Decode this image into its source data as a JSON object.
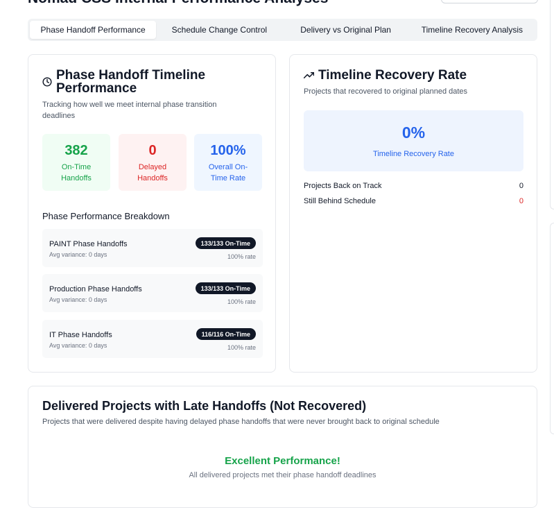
{
  "header": {
    "title_partial": "Nomad CSS Internal Performance Analyses"
  },
  "tabs": [
    {
      "label": "Phase Handoff Performance",
      "active": true
    },
    {
      "label": "Schedule Change Control",
      "active": false
    },
    {
      "label": "Delivery vs Original Plan",
      "active": false
    },
    {
      "label": "Timeline Recovery Analysis",
      "active": false
    }
  ],
  "handoff_card": {
    "icon": "clock-icon",
    "title_line1": "Phase Handoff Timeline",
    "title_line2": "Performance",
    "subtitle": "Tracking how well we meet internal phase transition deadlines",
    "stats": [
      {
        "value": "382",
        "line1": "On-Time",
        "line2": "Handoffs",
        "color": "#16a34a",
        "bg": "#f0fdf4"
      },
      {
        "value": "0",
        "line1": "Delayed",
        "line2": "Handoffs",
        "color": "#dc2626",
        "bg": "#fef2f2"
      },
      {
        "value": "100%",
        "line1": "Overall On-",
        "line2": "Time Rate",
        "color": "#2563eb",
        "bg": "#eff6ff"
      }
    ],
    "breakdown_title": "Phase Performance Breakdown",
    "phases": [
      {
        "name": "PAINT Phase Handoffs",
        "variance": "Avg variance: 0 days",
        "badge": "133/133 On-Time",
        "rate": "100% rate"
      },
      {
        "name": "Production Phase Handoffs",
        "variance": "Avg variance: 0 days",
        "badge": "133/133 On-Time",
        "rate": "100% rate"
      },
      {
        "name": "IT Phase Handoffs",
        "variance": "Avg variance: 0 days",
        "badge": "116/116 On-Time",
        "rate": "100% rate"
      }
    ]
  },
  "recovery_card": {
    "icon": "trending-up-icon",
    "title": "Timeline Recovery Rate",
    "subtitle": "Projects that recovered to original planned dates",
    "rate_value": "0%",
    "rate_label": "Timeline Recovery Rate",
    "rows": [
      {
        "label": "Projects Back on Track",
        "value": "0",
        "color": "#111827"
      },
      {
        "label": "Still Behind Schedule",
        "value": "0",
        "color": "#dc2626"
      }
    ]
  },
  "late_card": {
    "title": "Delivered Projects with Late Handoffs (Not Recovered)",
    "subtitle": "Projects that were delivered despite having delayed phase handoffs that were never brought back to original schedule",
    "success_title": "Excellent Performance!",
    "success_text": "All delivered projects met their phase handoff deadlines"
  }
}
